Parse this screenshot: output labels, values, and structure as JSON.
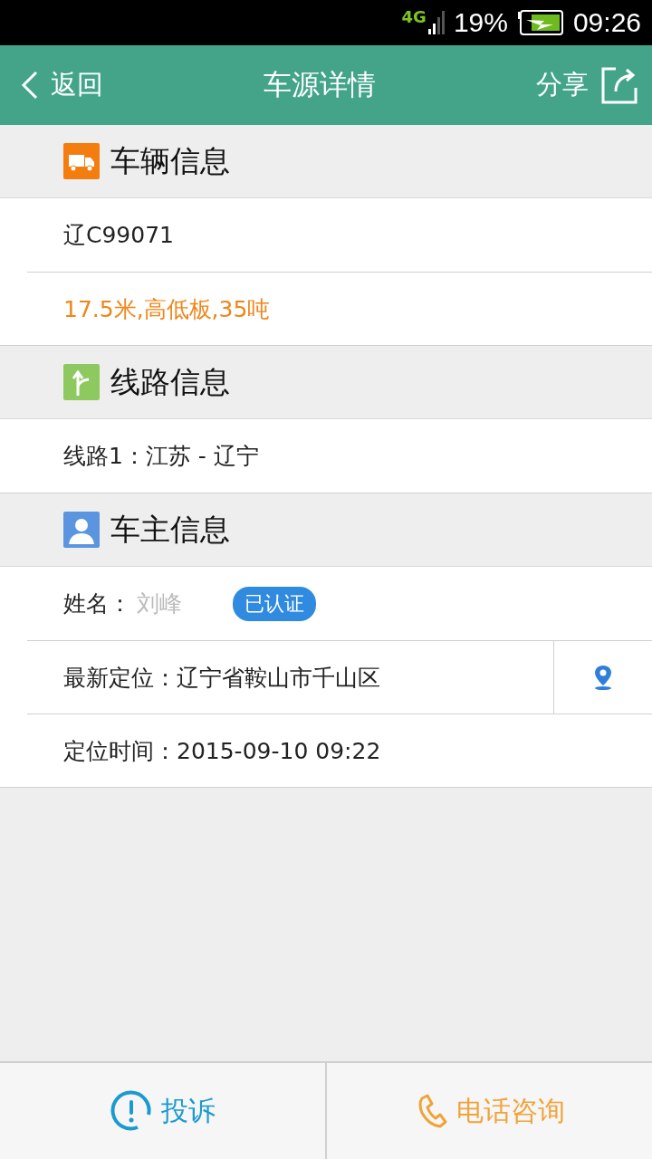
{
  "status_bar": {
    "network": "4G",
    "battery": "19%",
    "time": "09:26"
  },
  "header": {
    "back": "返回",
    "title": "车源详情",
    "share": "分享"
  },
  "sections": [
    {
      "kind": "truck",
      "title": "车辆信息",
      "rows": [
        {
          "kind": "plain",
          "text": "辽C99071"
        },
        {
          "kind": "highlight",
          "text": "17.5米,高低板,35吨"
        }
      ]
    },
    {
      "kind": "route",
      "title": "线路信息",
      "rows": [
        {
          "kind": "plain",
          "text": "线路1：江苏 - 辽宁"
        }
      ]
    },
    {
      "kind": "person",
      "title": "车主信息",
      "rows": [
        {
          "kind": "name",
          "label": "姓名：",
          "text": "刘峰",
          "badge": "已认证"
        },
        {
          "kind": "location",
          "text": "最新定位：辽宁省鞍山市千山区"
        },
        {
          "kind": "plain",
          "text": "定位时间：2015-09-10 09:22"
        }
      ]
    }
  ],
  "bottom_bar": {
    "complain": "投诉",
    "call": "电话咨询"
  }
}
